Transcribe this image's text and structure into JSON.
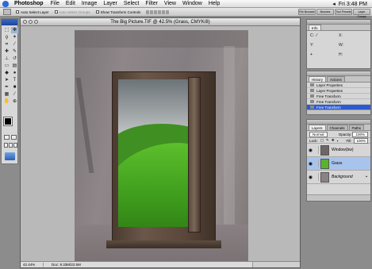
{
  "menubar": {
    "app": "Photoshop",
    "items": [
      "File",
      "Edit",
      "Image",
      "Layer",
      "Select",
      "Filter",
      "View",
      "Window",
      "Help"
    ],
    "clock": "Fri 3:48 PM"
  },
  "options": {
    "auto_select": "Auto Select Layer",
    "auto_select_groups": "Auto Select Groups",
    "show_transform": "Show Transform Controls",
    "palette_well": [
      "File Browser",
      "Brushes",
      "Tool Presets",
      "Layer Comps"
    ]
  },
  "document": {
    "title": "The Big Picture.TIF @ 42.5% (Grass, CMYK/8)",
    "zoom": "42.44%",
    "doc_size": "Doc: 8.33M/22.5M"
  },
  "info_palette": {
    "tabs": [
      "Info"
    ],
    "fields": [
      {
        "label": "C:",
        "value": ""
      },
      {
        "label": "X:",
        "value": ""
      },
      {
        "label": "Y:",
        "value": ""
      },
      {
        "label": "W:",
        "value": ""
      },
      {
        "label": "H:",
        "value": ""
      }
    ]
  },
  "history_palette": {
    "tabs": [
      "History",
      "Actions"
    ],
    "doc_label": "Doc: 8.33M/22.5M",
    "items": [
      "Layer Properties",
      "Layer Properties",
      "Free Transform",
      "Free Transform",
      "Free Transform"
    ],
    "active_index": 4
  },
  "layers_palette": {
    "tabs": [
      "Layers",
      "Channels",
      "Paths"
    ],
    "blend_mode": "Normal",
    "opacity_label": "Opacity:",
    "opacity": "100%",
    "lock_label": "Lock:",
    "fill_label": "Fill:",
    "fill": "100%",
    "layers": [
      {
        "name": "Window(bw)",
        "visible": true,
        "active": false,
        "thumb": "#6d6566"
      },
      {
        "name": "Grass",
        "visible": true,
        "active": true,
        "thumb": "#58b52b"
      },
      {
        "name": "Background",
        "visible": true,
        "active": false,
        "thumb": "#8a8284",
        "locked": true
      }
    ]
  },
  "colors": {
    "selection": "#2c5bd0",
    "grass": "#4faf24"
  }
}
